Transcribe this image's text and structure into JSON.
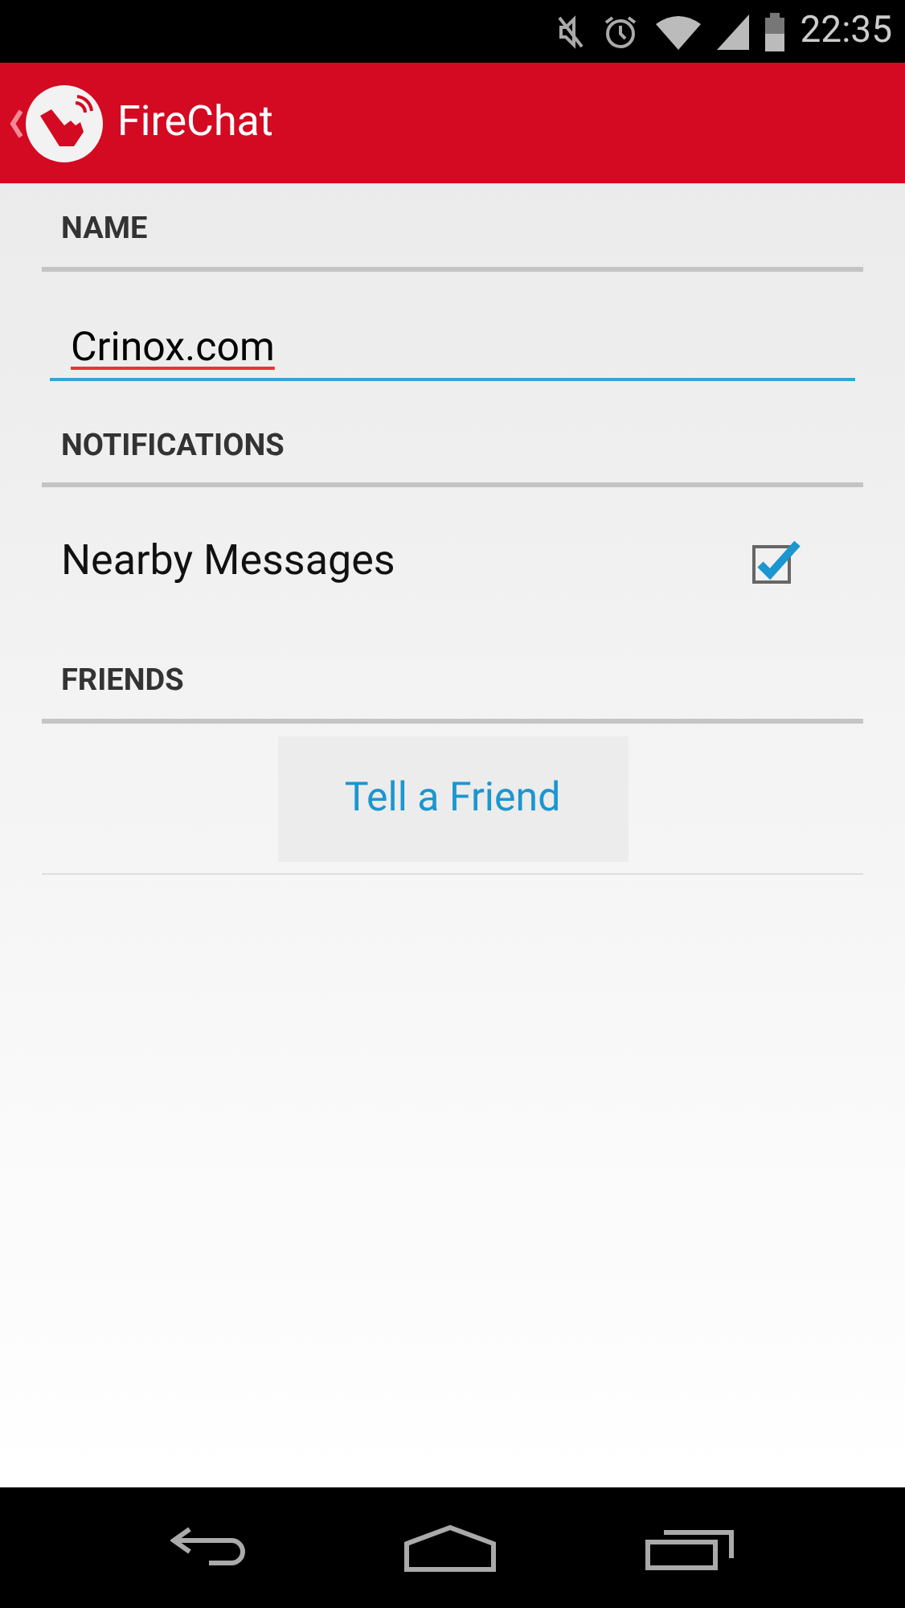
{
  "status_bar": {
    "time": "22:35"
  },
  "action_bar": {
    "title": "FireChat"
  },
  "sections": [
    {
      "header": "NAME",
      "kind": "field",
      "value": "Crinox.com"
    },
    {
      "header": "NOTIFICATIONS",
      "kind": "checkbox",
      "label": "Nearby Messages",
      "checked": true
    },
    {
      "header": "FRIENDS",
      "kind": "button",
      "label": "Tell a Friend"
    }
  ]
}
